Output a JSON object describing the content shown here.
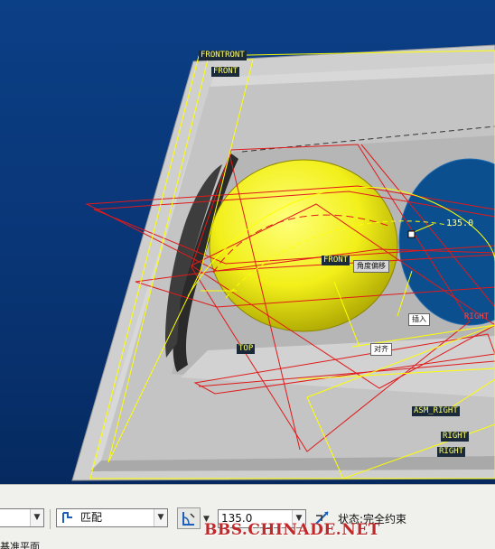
{
  "viewport": {
    "plane_labels": {
      "frontront": "FRONTRONT",
      "front_top": "FRONT",
      "front_mid": "FRONT",
      "top": "TOP",
      "asm_right": "ASM_RIGHT",
      "right_1": "RIGHT",
      "right_2": "RIGHT",
      "right_edge": "RIGHT"
    },
    "callouts": {
      "angle_offset": "角度偏移",
      "insert": "插入",
      "align": "对齐"
    },
    "dimension_value": "135.0",
    "colors": {
      "background": "#0b3f86",
      "plate": "#c8c8c8",
      "sphere": "#f2ef1a",
      "datum_planes": "#e01a1a",
      "assembly_planes": "#ffff00"
    }
  },
  "dashboard": {
    "first_combo_value": "",
    "constraint_type": "匹配",
    "offset_value": "135.0",
    "status_label": "状态:",
    "status_value": "完全约束",
    "bottom_label": "基准平面",
    "watermark": "BBS.CHINADE.NET"
  }
}
